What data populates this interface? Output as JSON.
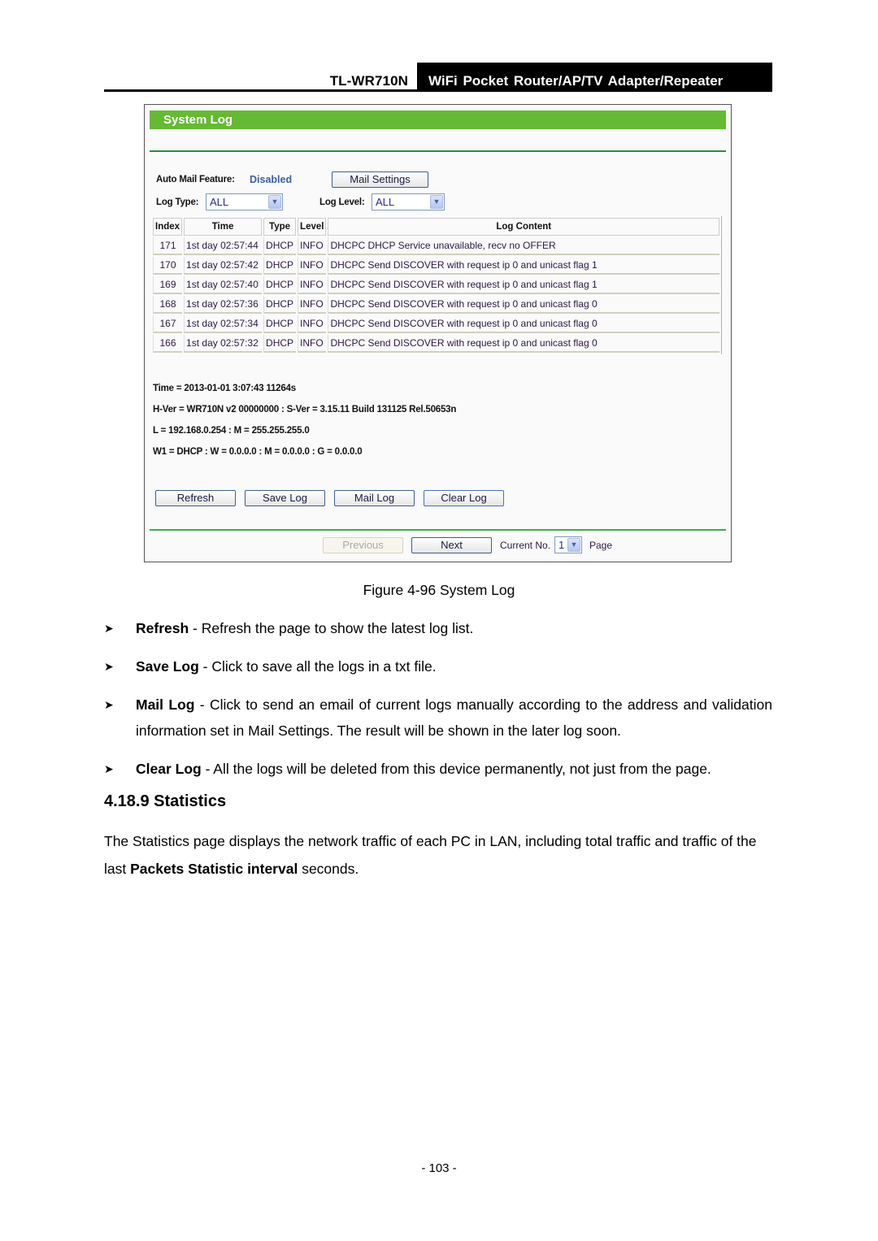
{
  "header": {
    "model": "TL-WR710N",
    "product": "WiFi Pocket Router/AP/TV Adapter/Repeater"
  },
  "screenshot": {
    "title": "System Log",
    "auto_mail_label": "Auto Mail Feature:",
    "auto_mail_value": "Disabled",
    "mail_settings_button": "Mail Settings",
    "log_type_label": "Log Type:",
    "log_type_value": "ALL",
    "log_level_label": "Log Level:",
    "log_level_value": "ALL",
    "table": {
      "headers": [
        "Index",
        "Time",
        "Type",
        "Level",
        "Log Content"
      ],
      "rows": [
        [
          "171",
          "1st day 02:57:44",
          "DHCP",
          "INFO",
          "DHCPC DHCP Service unavailable, recv no OFFER"
        ],
        [
          "170",
          "1st day 02:57:42",
          "DHCP",
          "INFO",
          "DHCPC Send DISCOVER with request ip 0 and unicast flag 1"
        ],
        [
          "169",
          "1st day 02:57:40",
          "DHCP",
          "INFO",
          "DHCPC Send DISCOVER with request ip 0 and unicast flag 1"
        ],
        [
          "168",
          "1st day 02:57:36",
          "DHCP",
          "INFO",
          "DHCPC Send DISCOVER with request ip 0 and unicast flag 0"
        ],
        [
          "167",
          "1st day 02:57:34",
          "DHCP",
          "INFO",
          "DHCPC Send DISCOVER with request ip 0 and unicast flag 0"
        ],
        [
          "166",
          "1st day 02:57:32",
          "DHCP",
          "INFO",
          "DHCPC Send DISCOVER with request ip 0 and unicast flag 0"
        ]
      ]
    },
    "sysinfo": [
      "Time = 2013-01-01 3:07:43 11264s",
      "H-Ver = WR710N v2 00000000 : S-Ver = 3.15.11 Build 131125 Rel.50653n",
      "L = 192.168.0.254 : M = 255.255.255.0",
      "W1 = DHCP : W = 0.0.0.0 : M = 0.0.0.0 : G = 0.0.0.0"
    ],
    "buttons": {
      "refresh": "Refresh",
      "save_log": "Save Log",
      "mail_log": "Mail Log",
      "clear_log": "Clear Log"
    },
    "pager": {
      "previous": "Previous",
      "next": "Next",
      "current_label": "Current No.",
      "current_value": "1",
      "page_label": "Page"
    }
  },
  "caption": "Figure 4-96 System Log",
  "bullets": [
    {
      "term": "Refresh",
      "text": " - Refresh the page to show the latest log list."
    },
    {
      "term": "Save Log",
      "text": " - Click to save all the logs in a txt file."
    },
    {
      "term": "Mail Log",
      "text": " - Click to send an email of current logs manually according to the address and validation information set in Mail Settings. The result will be shown in the later log soon."
    },
    {
      "term": "Clear Log",
      "text": " - All the logs will be deleted from this device permanently, not just from the page."
    }
  ],
  "section": {
    "heading": "4.18.9 Statistics",
    "para_before": "The Statistics page displays the network traffic of each PC in LAN, including total traffic and traffic of the last ",
    "para_bold": "Packets Statistic interval",
    "para_after": " seconds."
  },
  "page_number": "- 103 -",
  "icons": {
    "bullet": "arrowhead-bullet-icon",
    "dropdown": "chevron-down-icon"
  },
  "colors": {
    "title_bar": "#66b933",
    "rule": "#2e8b3e",
    "disabled_value": "#3a5ea8"
  }
}
